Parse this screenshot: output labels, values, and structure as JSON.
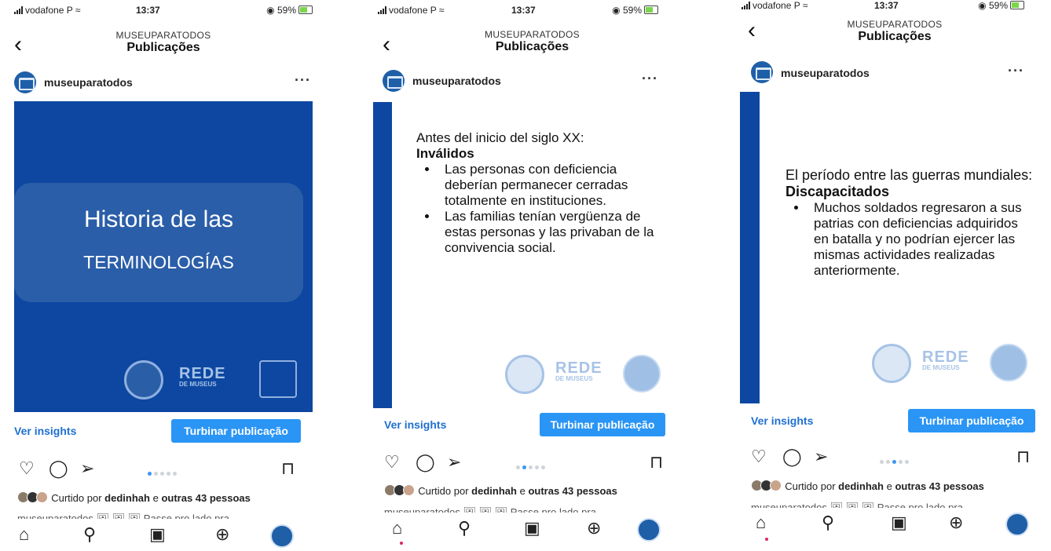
{
  "status": {
    "carrier": "vodafone P",
    "time": "13:37",
    "battery": "59%"
  },
  "header": {
    "back_icon": "chevron-left-icon",
    "account": "MUSEUPARATODOS",
    "title": "Publicações"
  },
  "post": {
    "username": "museuparatodos",
    "more": "···"
  },
  "actions": {
    "insights": "Ver insights",
    "boost": "Turbinar publicação"
  },
  "likes": {
    "prefix": "Curtido por",
    "user": "dedinhah",
    "joiner": "e",
    "others": "outras 43 pessoas"
  },
  "caption_cut": "museuparatodos 🖼 🖼 🖼  Passe pro lado pra ...",
  "colors": {
    "brand_blue": "#0d47a1",
    "boost_blue": "#2a95f5",
    "link_blue": "#1f6fd1"
  },
  "logos": {
    "rede_line1": "REDE",
    "rede_line2": "DE MUSEUS"
  },
  "slides": [
    {
      "title_line1": "Historia de las",
      "title_line2": "TERMINOLOGÍAS",
      "active_dot": 0
    },
    {
      "heading": "Antes del inicio del siglo XX:",
      "heading_bold": "Inválidos",
      "bullets": [
        "Las personas con deficiencia deberían permanecer cerradas totalmente en instituciones.",
        "Las familias tenían vergüenza de estas personas y las privaban de la convivencia social."
      ],
      "active_dot": 1
    },
    {
      "heading": "El período entre las guerras mundiales:",
      "heading_bold": "Discapacitados",
      "bullets": [
        "Muchos soldados regresaron a sus patrias con deficiencias adquiridos en batalla y no podrían ejercer las mismas actividades realizadas anteriormente."
      ],
      "active_dot": 2
    }
  ]
}
